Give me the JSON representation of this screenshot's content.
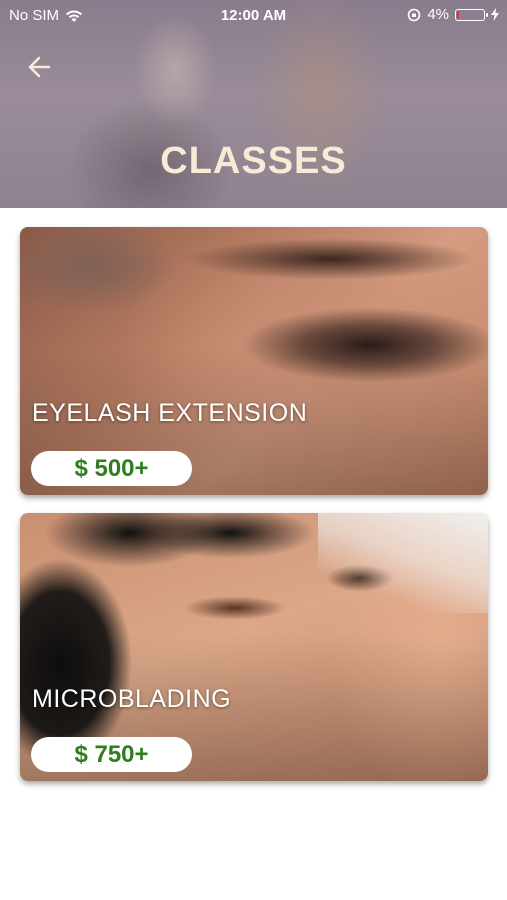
{
  "status_bar": {
    "carrier": "No SIM",
    "time": "12:00 AM",
    "battery_percent": "4%",
    "battery_color": "#e53030"
  },
  "header": {
    "title": "CLASSES",
    "back_icon": "arrow-left-icon"
  },
  "classes": [
    {
      "name": "EYELASH EXTENSION",
      "price": "$ 500+"
    },
    {
      "name": "MICROBLADING",
      "price": "$ 750+"
    }
  ],
  "colors": {
    "title": "#f7ead7",
    "price_text": "#2f7d1e"
  }
}
